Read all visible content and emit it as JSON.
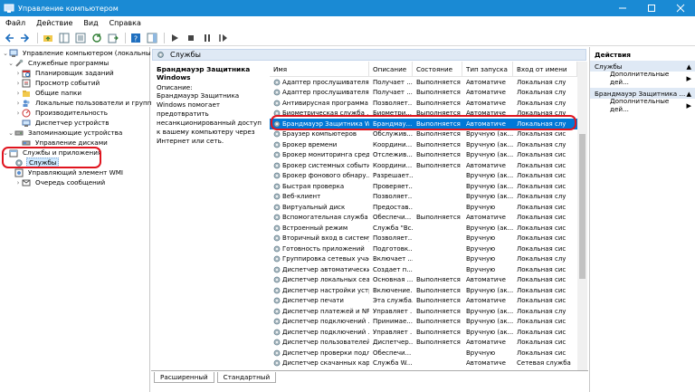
{
  "window": {
    "title": "Управление компьютером",
    "accent_color": "#1a8ad4",
    "highlight_color": "#e0141e"
  },
  "menu": [
    "Файл",
    "Действие",
    "Вид",
    "Справка"
  ],
  "tree": {
    "root": "Управление компьютером (локальным)",
    "utilities": "Служебные программы",
    "scheduler": "Планировщик заданий",
    "eventviewer": "Просмотр событий",
    "shared": "Общие папки",
    "localusers": "Локальные пользователи и группы",
    "performance": "Производительность",
    "devmgr": "Диспетчер устройств",
    "storage": "Запоминающие устройства",
    "diskmgmt": "Управление дисками",
    "services_apps": "Службы и приложения",
    "services": "Службы",
    "wmi": "Управляющий элемент WMI",
    "msgqueue": "Очередь сообщений"
  },
  "center": {
    "tab_title": "Службы",
    "selected_service": "Брандмауэр Защитника Windows",
    "desc_label": "Описание:",
    "desc_text": "Брандмауэр Защитника Windows помогает предотвратить несанкционированный доступ к вашему компьютеру через Интернет или сеть.",
    "columns": [
      "Имя",
      "Описание",
      "Состояние",
      "Тип запуска",
      "Вход от имени"
    ],
    "rows": [
      [
        "Адаптер прослушивателя ...",
        "Получает ...",
        "Выполняется",
        "Автоматиче",
        "Локальная слу"
      ],
      [
        "Адаптер прослушивателя ...",
        "Получает ...",
        "Выполняется",
        "Автоматиче",
        "Локальная слу"
      ],
      [
        "Антивирусная программа ...",
        "Позволяет...",
        "Выполняется",
        "Автоматиче",
        "Локальная слу"
      ],
      [
        "Биометрическая служба ...",
        "Биометри...",
        "Выполняется",
        "Автоматиче",
        "Локальная слу"
      ],
      [
        "Брандмауэр Защитника W...",
        "Брандмау...",
        "Выполняется",
        "Автоматиче",
        "Локальная слу"
      ],
      [
        "Браузер компьютеров",
        "Обслужив...",
        "Выполняется",
        "Вручную (ак...",
        "Локальная сис"
      ],
      [
        "Брокер времени",
        "Координи...",
        "Выполняется",
        "Вручную (ак...",
        "Локальная слу"
      ],
      [
        "Брокер мониторинга сред...",
        "Отслежив...",
        "Выполняется",
        "Вручную (ак...",
        "Локальная сис"
      ],
      [
        "Брокер системных событий",
        "Координи...",
        "Выполняется",
        "Автоматиче",
        "Локальная сис"
      ],
      [
        "Брокер фонового обнару...",
        "Разрешает...",
        "",
        "Вручную (ак...",
        "Локальная сис"
      ],
      [
        "Быстрая проверка",
        "Проверяет...",
        "",
        "Вручную (ак...",
        "Локальная сис"
      ],
      [
        "Веб-клиент",
        "Позволяет...",
        "",
        "Вручную (ак...",
        "Локальная слу"
      ],
      [
        "Виртуальный диск",
        "Предостав...",
        "",
        "Вручную",
        "Локальная сис"
      ],
      [
        "Вспомогательная служба IP",
        "Обеспечи...",
        "Выполняется",
        "Автоматиче",
        "Локальная сис"
      ],
      [
        "Встроенный режим",
        "Служба \"Вс...",
        "",
        "Вручную (ак...",
        "Локальная сис"
      ],
      [
        "Вторичный вход в систему",
        "Позволяет...",
        "",
        "Вручную",
        "Локальная сис"
      ],
      [
        "Готовность приложений",
        "Подготовк...",
        "",
        "Вручную",
        "Локальная сис"
      ],
      [
        "Группировка сетевых учас...",
        "Включает ...",
        "",
        "Вручную",
        "Локальная слу"
      ],
      [
        "Диспетчер автоматически...",
        "Создает п...",
        "",
        "Вручную",
        "Локальная сис"
      ],
      [
        "Диспетчер локальных сеа...",
        "Основная ...",
        "Выполняется",
        "Автоматиче",
        "Локальная сис"
      ],
      [
        "Диспетчер настройки устр...",
        "Включение...",
        "Выполняется",
        "Вручную (ак...",
        "Локальная сис"
      ],
      [
        "Диспетчер печати",
        "Эта служба...",
        "Выполняется",
        "Автоматиче",
        "Локальная сис"
      ],
      [
        "Диспетчер платежей и NF...",
        "Управляет ...",
        "Выполняется",
        "Вручную (ак...",
        "Локальная слу"
      ],
      [
        "Диспетчер подключений ...",
        "Принимае...",
        "Выполняется",
        "Вручную (ак...",
        "Локальная сис"
      ],
      [
        "Диспетчер подключений ...",
        "Управляет ...",
        "Выполняется",
        "Вручную (ак...",
        "Локальная сис"
      ],
      [
        "Диспетчер пользователей",
        "Диспетчер...",
        "Выполняется",
        "Автоматиче",
        "Локальная сис"
      ],
      [
        "Диспетчер проверки подл...",
        "Обеспечи...",
        "",
        "Вручную",
        "Локальная сис"
      ],
      [
        "Диспетчер скачанных карт",
        "Служба W...",
        "",
        "Автоматиче",
        "Сетевая служба"
      ]
    ],
    "bottom_tabs": [
      "Расширенный",
      "Стандартный"
    ]
  },
  "actions": {
    "header": "Действия",
    "section1": "Службы",
    "more1": "Дополнительные дей...",
    "section2": "Брандмауэр Защитника ...",
    "more2": "Дополнительные дей..."
  }
}
